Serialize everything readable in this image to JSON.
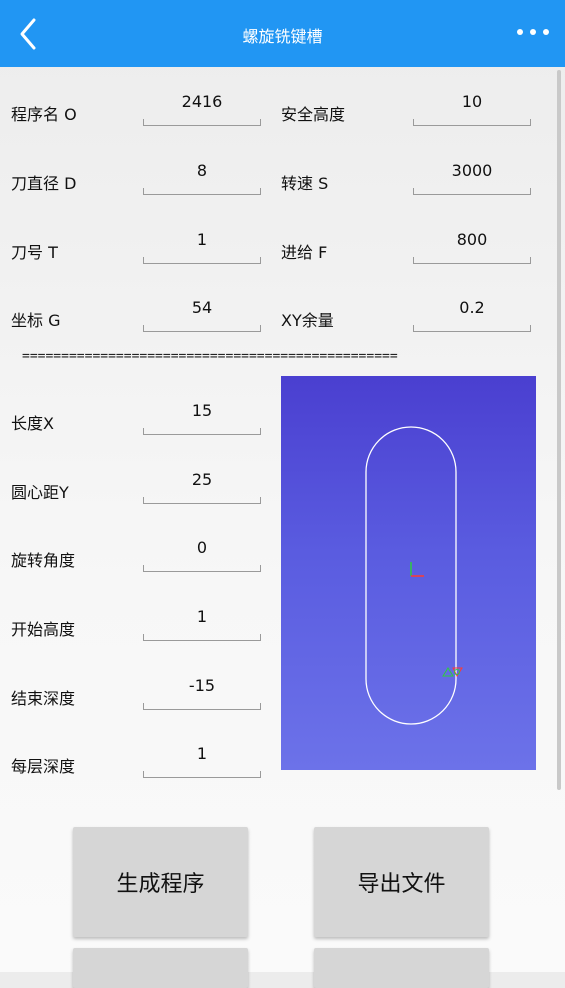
{
  "header": {
    "title": "螺旋铣键槽"
  },
  "params": [
    {
      "label": "程序名 O",
      "value": "2416"
    },
    {
      "label": "安全高度",
      "value": "10"
    },
    {
      "label": "刀直径 D",
      "value": "8"
    },
    {
      "label": "转速 S",
      "value": "3000"
    },
    {
      "label": "刀号 T",
      "value": "1"
    },
    {
      "label": "进给 F",
      "value": "800"
    },
    {
      "label": "坐标 G",
      "value": "54"
    },
    {
      "label": "XY余量",
      "value": "0.2"
    }
  ],
  "separator": "================================================",
  "geometry": [
    {
      "label": "长度X",
      "value": "15"
    },
    {
      "label": "圆心距Y",
      "value": "25"
    },
    {
      "label": "旋转角度",
      "value": "0"
    },
    {
      "label": "开始高度",
      "value": "1"
    },
    {
      "label": "结束深度",
      "value": "-15"
    },
    {
      "label": "每层深度",
      "value": "1"
    }
  ],
  "buttons": {
    "generate": "生成程序",
    "export": "导出文件",
    "button3": "",
    "button4": ""
  },
  "colors": {
    "header": "#2196f3",
    "preview_top": "#4a3fd0",
    "preview_bottom": "#6c72e9"
  }
}
